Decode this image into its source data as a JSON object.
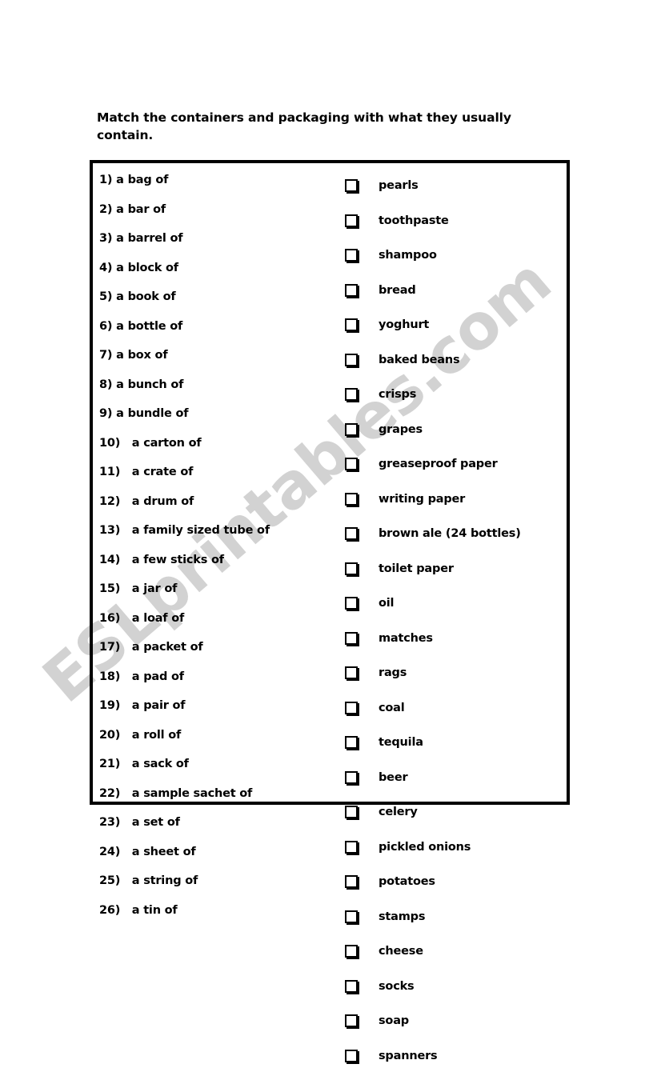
{
  "document": {
    "title_line1": "Match the containers and packaging with what they usually",
    "title_line2": "contain.",
    "watermark": "ESLprintables.com",
    "watermark_color": "#d2d2d2",
    "ink_color": "#000000",
    "paper_color": "#ffffff"
  },
  "exercise": {
    "left_column": [
      {
        "num": "1)",
        "text": " a bag of"
      },
      {
        "num": "2)",
        "text": " a bar of"
      },
      {
        "num": "3)",
        "text": " a barrel of"
      },
      {
        "num": "4)",
        "text": " a block of"
      },
      {
        "num": "5)",
        "text": " a book of"
      },
      {
        "num": "6)",
        "text": " a bottle of"
      },
      {
        "num": "7)",
        "text": " a box of"
      },
      {
        "num": "8)",
        "text": " a bunch of"
      },
      {
        "num": "9)",
        "text": " a bundle of"
      },
      {
        "num": "10)",
        "text": "   a carton of"
      },
      {
        "num": "11)",
        "text": "   a crate of"
      },
      {
        "num": "12)",
        "text": "   a drum of"
      },
      {
        "num": "13)",
        "text": "   a family sized tube of"
      },
      {
        "num": "14)",
        "text": "   a few sticks of"
      },
      {
        "num": "15)",
        "text": "   a jar of"
      },
      {
        "num": "16)",
        "text": "   a loaf of"
      },
      {
        "num": "17)",
        "text": "   a packet of"
      },
      {
        "num": "18)",
        "text": "   a pad of"
      },
      {
        "num": "19)",
        "text": "   a pair of"
      },
      {
        "num": "20)",
        "text": "   a roll of"
      },
      {
        "num": "21)",
        "text": "   a sack of"
      },
      {
        "num": "22)",
        "text": "   a sample sachet of"
      },
      {
        "num": "23)",
        "text": "   a set of"
      },
      {
        "num": "24)",
        "text": "   a sheet of"
      },
      {
        "num": "25)",
        "text": "   a string of"
      },
      {
        "num": "26)",
        "text": "   a tin of"
      }
    ],
    "right_column": [
      {
        "checkbox": "empty-checkbox",
        "label": "pearls"
      },
      {
        "checkbox": "empty-checkbox",
        "label": "toothpaste"
      },
      {
        "checkbox": "empty-checkbox",
        "label": "shampoo"
      },
      {
        "checkbox": "empty-checkbox",
        "label": "bread"
      },
      {
        "checkbox": "empty-checkbox",
        "label": "yoghurt"
      },
      {
        "checkbox": "empty-checkbox",
        "label": "baked beans"
      },
      {
        "checkbox": "empty-checkbox",
        "label": "crisps"
      },
      {
        "checkbox": "empty-checkbox",
        "label": "grapes"
      },
      {
        "checkbox": "empty-checkbox",
        "label": "greaseproof paper"
      },
      {
        "checkbox": "empty-checkbox",
        "label": "writing paper"
      },
      {
        "checkbox": "empty-checkbox",
        "label": "brown ale (24 bottles)"
      },
      {
        "checkbox": "empty-checkbox",
        "label": "toilet paper"
      },
      {
        "checkbox": "empty-checkbox",
        "label": "oil"
      },
      {
        "checkbox": "empty-checkbox",
        "label": "matches"
      },
      {
        "checkbox": "empty-checkbox",
        "label": "rags"
      },
      {
        "checkbox": "empty-checkbox",
        "label": "coal"
      },
      {
        "checkbox": "empty-checkbox",
        "label": "tequila"
      },
      {
        "checkbox": "empty-checkbox",
        "label": "beer"
      },
      {
        "checkbox": "empty-checkbox",
        "label": "celery"
      },
      {
        "checkbox": "empty-checkbox",
        "label": "pickled onions"
      },
      {
        "checkbox": "empty-checkbox",
        "label": "potatoes"
      },
      {
        "checkbox": "empty-checkbox",
        "label": "stamps"
      },
      {
        "checkbox": "empty-checkbox",
        "label": "cheese"
      },
      {
        "checkbox": "empty-checkbox",
        "label": "socks"
      },
      {
        "checkbox": "empty-checkbox",
        "label": "soap"
      },
      {
        "checkbox": "empty-checkbox",
        "label": "spanners"
      }
    ]
  }
}
